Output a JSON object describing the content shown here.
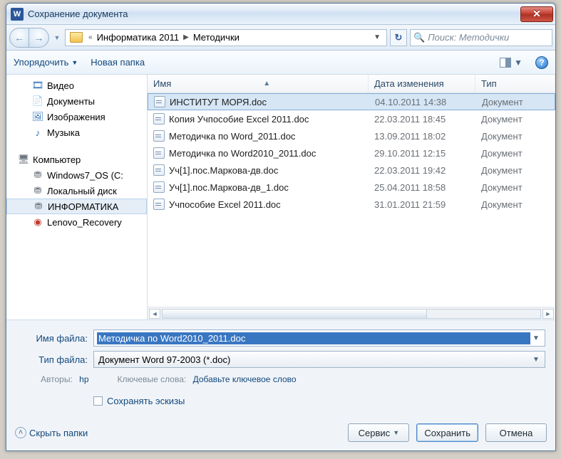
{
  "title": "Сохранение документа",
  "breadcrumb": {
    "seg1": "Информатика 2011",
    "seg2": "Методички"
  },
  "search": {
    "placeholder": "Поиск: Методички"
  },
  "toolbar": {
    "organize": "Упорядочить",
    "newfolder": "Новая папка"
  },
  "tree": {
    "video": "Видео",
    "documents": "Документы",
    "images": "Изображения",
    "music": "Музыка",
    "computer": "Компьютер",
    "drive_os": "Windows7_OS (C:",
    "drive_local": "Локальный диск",
    "drive_info": "ИНФОРМАТИКА",
    "drive_lenovo": "Lenovo_Recovery"
  },
  "columns": {
    "name": "Имя",
    "date": "Дата изменения",
    "type": "Тип"
  },
  "files": [
    {
      "name": "ИНСТИТУТ МОРЯ.doc",
      "date": "04.10.2011 14:38",
      "type": "Документ"
    },
    {
      "name": "Копия Учпособие Excel 2011.doc",
      "date": "22.03.2011 18:45",
      "type": "Документ"
    },
    {
      "name": "Методичка по Word_2011.doc",
      "date": "13.09.2011 18:02",
      "type": "Документ"
    },
    {
      "name": "Методичка по Word2010_2011.doc",
      "date": "29.10.2011 12:15",
      "type": "Документ"
    },
    {
      "name": "Уч[1].пос.Маркова-дв.doc",
      "date": "22.03.2011 19:42",
      "type": "Документ"
    },
    {
      "name": "Уч[1].пос.Маркова-дв_1.doc",
      "date": "25.04.2011 18:58",
      "type": "Документ"
    },
    {
      "name": "Учпособие Excel 2011.doc",
      "date": "31.01.2011 21:59",
      "type": "Документ"
    }
  ],
  "form": {
    "filename_label": "Имя файла:",
    "filename_value": "Методичка по Word2010_2011.doc",
    "filetype_label": "Тип файла:",
    "filetype_value": "Документ Word 97-2003 (*.doc)",
    "authors_label": "Авторы:",
    "authors_value": "hp",
    "keywords_label": "Ключевые слова:",
    "keywords_value": "Добавьте ключевое слово",
    "save_thumbs": "Сохранять эскизы"
  },
  "footer": {
    "hide": "Скрыть папки",
    "tools": "Сервис",
    "save": "Сохранить",
    "cancel": "Отмена"
  }
}
